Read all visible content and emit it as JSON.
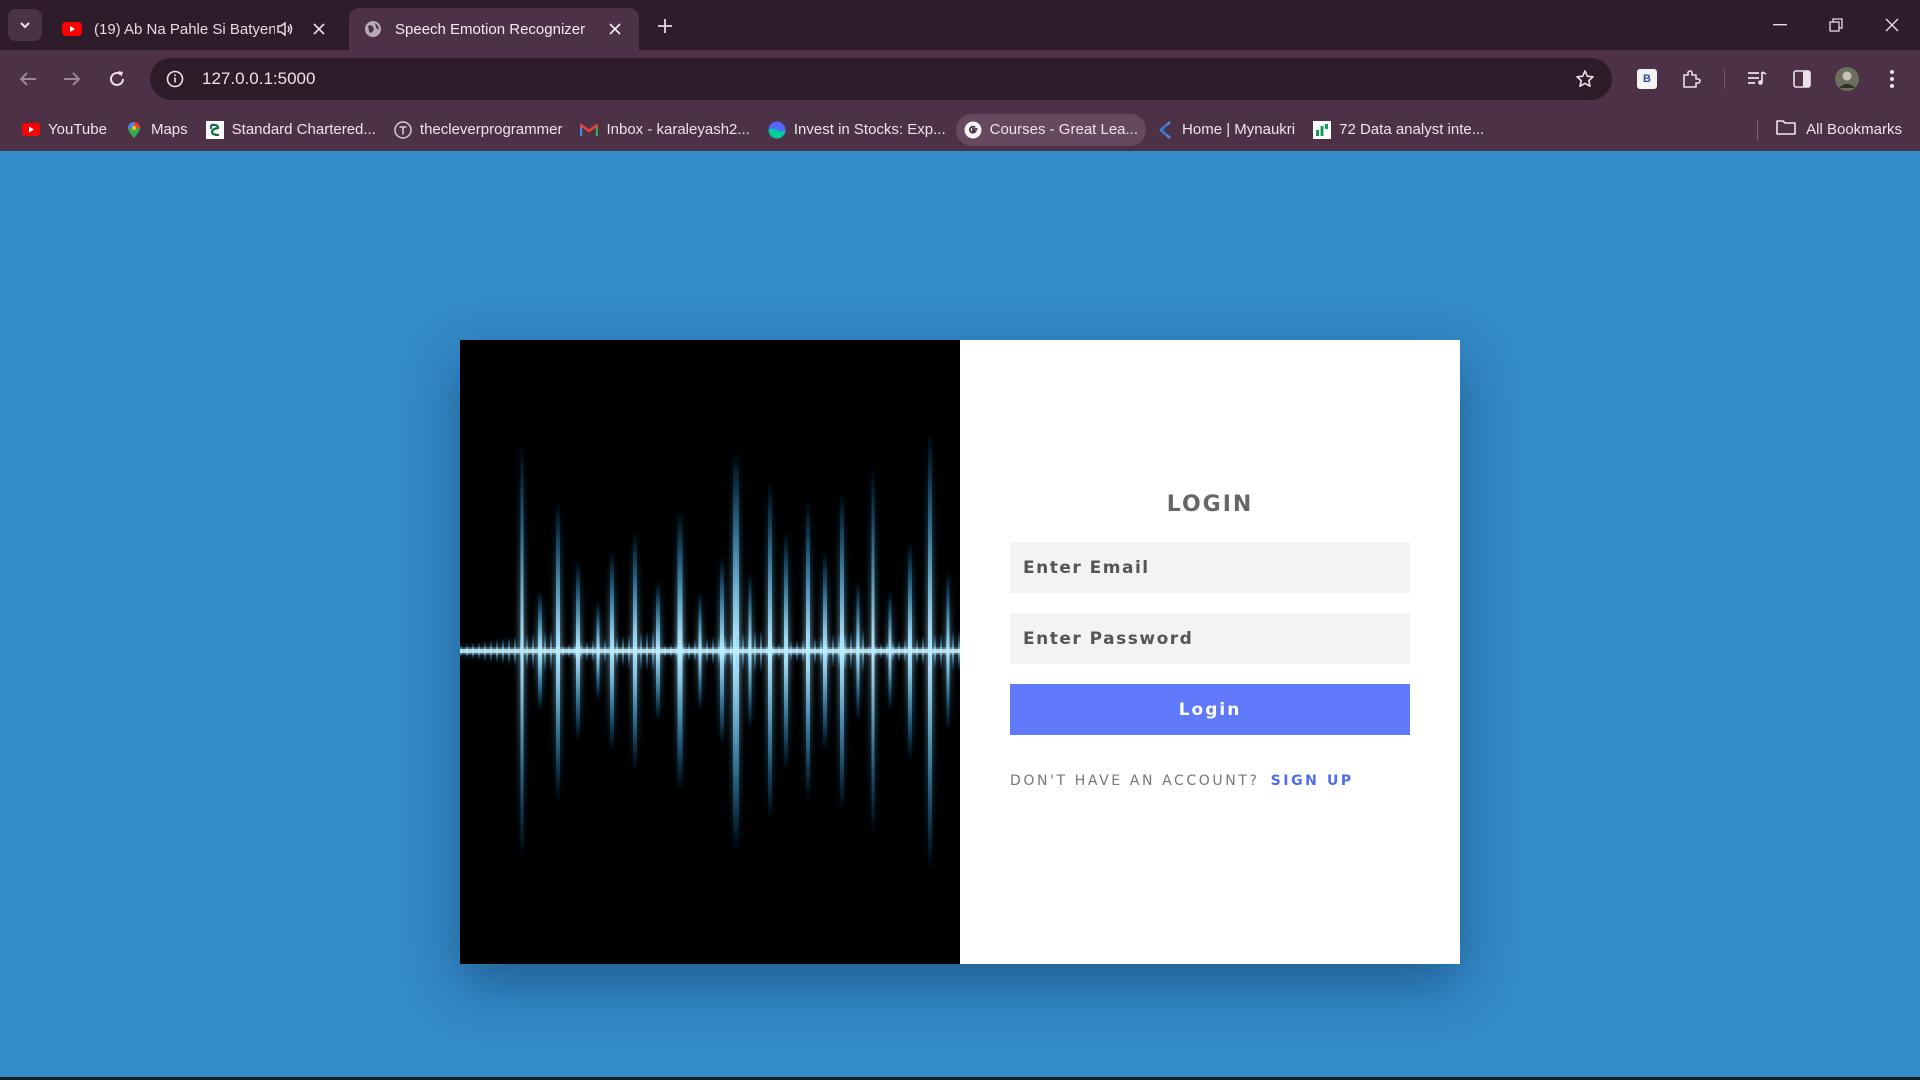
{
  "browser": {
    "tabs": [
      {
        "title": "(19) Ab Na Pahle Si Batyen |",
        "icon": "youtube-icon",
        "audio": true,
        "active": false
      },
      {
        "title": "Speech Emotion Recognizer",
        "icon": "globe-icon",
        "audio": false,
        "active": true
      }
    ],
    "url": "127.0.0.1:5000",
    "bookmarks": [
      {
        "label": "YouTube",
        "icon": "youtube-icon"
      },
      {
        "label": "Maps",
        "icon": "maps-icon"
      },
      {
        "label": "Standard Chartered...",
        "icon": "standard-chartered-icon"
      },
      {
        "label": "thecleverprogrammer",
        "icon": "tcp-icon"
      },
      {
        "label": "Inbox - karaleyash2...",
        "icon": "gmail-icon"
      },
      {
        "label": "Invest in Stocks: Exp...",
        "icon": "stocks-icon"
      },
      {
        "label": "Courses - Great Lea...",
        "icon": "google-icon"
      },
      {
        "label": "Home | Mynaukri",
        "icon": "mynaukri-icon"
      },
      {
        "label": "72 Data analyst inte...",
        "icon": "sheet-icon"
      }
    ],
    "all_bookmarks_label": "All Bookmarks",
    "extension_badge": "B"
  },
  "page": {
    "background": "#338bc9",
    "login": {
      "title": "LOGIN",
      "email_placeholder": "Enter Email",
      "password_placeholder": "Enter Password",
      "button_label": "Login",
      "prompt": "DON'T HAVE AN ACCOUNT?",
      "signup_label": "SIGN UP",
      "accent": "#6079fb"
    }
  }
}
